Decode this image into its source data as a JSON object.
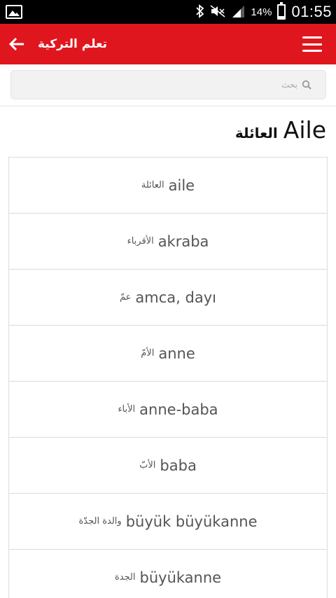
{
  "status_bar": {
    "icons": [
      "gallery-icon",
      "bluetooth-icon",
      "mute-icon",
      "signal-icon",
      "battery-icon"
    ],
    "battery_percent": "14%",
    "battery_level": 0.14,
    "time": "01:55"
  },
  "app_bar": {
    "title": "تعلم التركية",
    "back_icon": "arrow-left-icon",
    "menu_icon": "hamburger-menu-icon",
    "background_color": "#e0161e"
  },
  "search": {
    "placeholder": "بحث",
    "icon": "search-icon"
  },
  "heading": {
    "turkish": "Aile",
    "arabic": "العائلة"
  },
  "words": [
    {
      "turkish": "aile",
      "arabic": "العائلة"
    },
    {
      "turkish": "akraba",
      "arabic": "الأقرباء"
    },
    {
      "turkish": "amca, dayı",
      "arabic": "عمّ"
    },
    {
      "turkish": "anne",
      "arabic": "الأمّ"
    },
    {
      "turkish": "anne-baba",
      "arabic": "الأباء"
    },
    {
      "turkish": "baba",
      "arabic": "الأبّ"
    },
    {
      "turkish": "büyük büyükanne",
      "arabic": "والدة الجدّة"
    },
    {
      "turkish": "büyükanne",
      "arabic": "الجدة"
    }
  ]
}
